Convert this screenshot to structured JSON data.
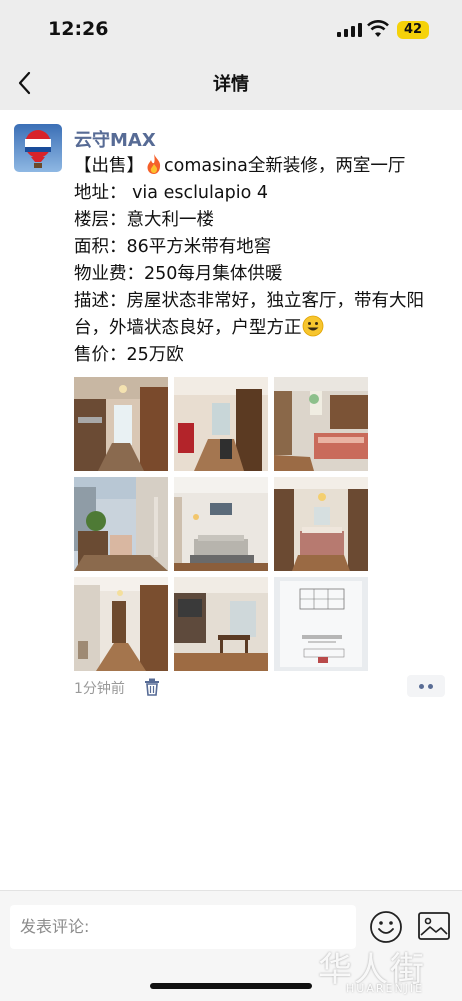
{
  "status_bar": {
    "time": "12:26",
    "battery": "42"
  },
  "nav": {
    "title": "详情"
  },
  "post": {
    "username": "云守MAX",
    "lines": {
      "l1_prefix": "【出售】",
      "l1_text": "comasina全新装修，两室一厅",
      "address": "地址： via esclulapio 4",
      "floor": "楼层：意大利一楼",
      "area": "面积：86平方米带有地窖",
      "fee": "物业费：250每月集体供暖",
      "desc": "描述：房屋状态非常好，独立客厅，带有大阳台，外墙状态良好，户型方正",
      "price": "售价：25万欧"
    },
    "time_ago": "1分钟前",
    "photos": [
      {
        "name": "kitchen-photo"
      },
      {
        "name": "hallway-photo"
      },
      {
        "name": "bedroom-photo"
      },
      {
        "name": "balcony-photo"
      },
      {
        "name": "living-room-photo"
      },
      {
        "name": "master-bedroom-photo"
      },
      {
        "name": "corridor-photo"
      },
      {
        "name": "dining-room-photo"
      },
      {
        "name": "floor-plan-photo"
      }
    ]
  },
  "comment": {
    "placeholder": "发表评论:"
  },
  "watermark": {
    "cn": "华人街",
    "en": "HUARENJIE"
  },
  "colors": {
    "username": "#576b95",
    "background": "#ededed",
    "battery": "#f5d20a"
  }
}
